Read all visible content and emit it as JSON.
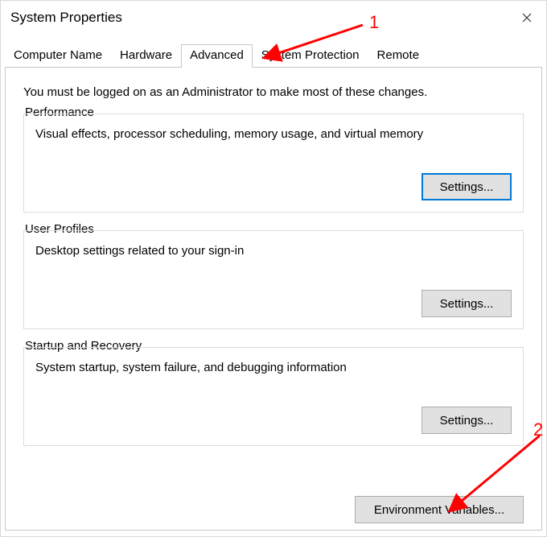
{
  "window": {
    "title": "System Properties"
  },
  "tabs": {
    "computer_name": "Computer Name",
    "hardware": "Hardware",
    "advanced": "Advanced",
    "system_protection": "System Protection",
    "remote": "Remote"
  },
  "panel": {
    "intro": "You must be logged on as an Administrator to make most of these changes.",
    "performance": {
      "legend": "Performance",
      "desc": "Visual effects, processor scheduling, memory usage, and virtual memory",
      "settings_label": "Settings..."
    },
    "user_profiles": {
      "legend": "User Profiles",
      "desc": "Desktop settings related to your sign-in",
      "settings_label": "Settings..."
    },
    "startup_recovery": {
      "legend": "Startup and Recovery",
      "desc": "System startup, system failure, and debugging information",
      "settings_label": "Settings..."
    },
    "env_vars_label": "Environment Variables..."
  },
  "annotations": {
    "one": "1",
    "two": "2"
  }
}
